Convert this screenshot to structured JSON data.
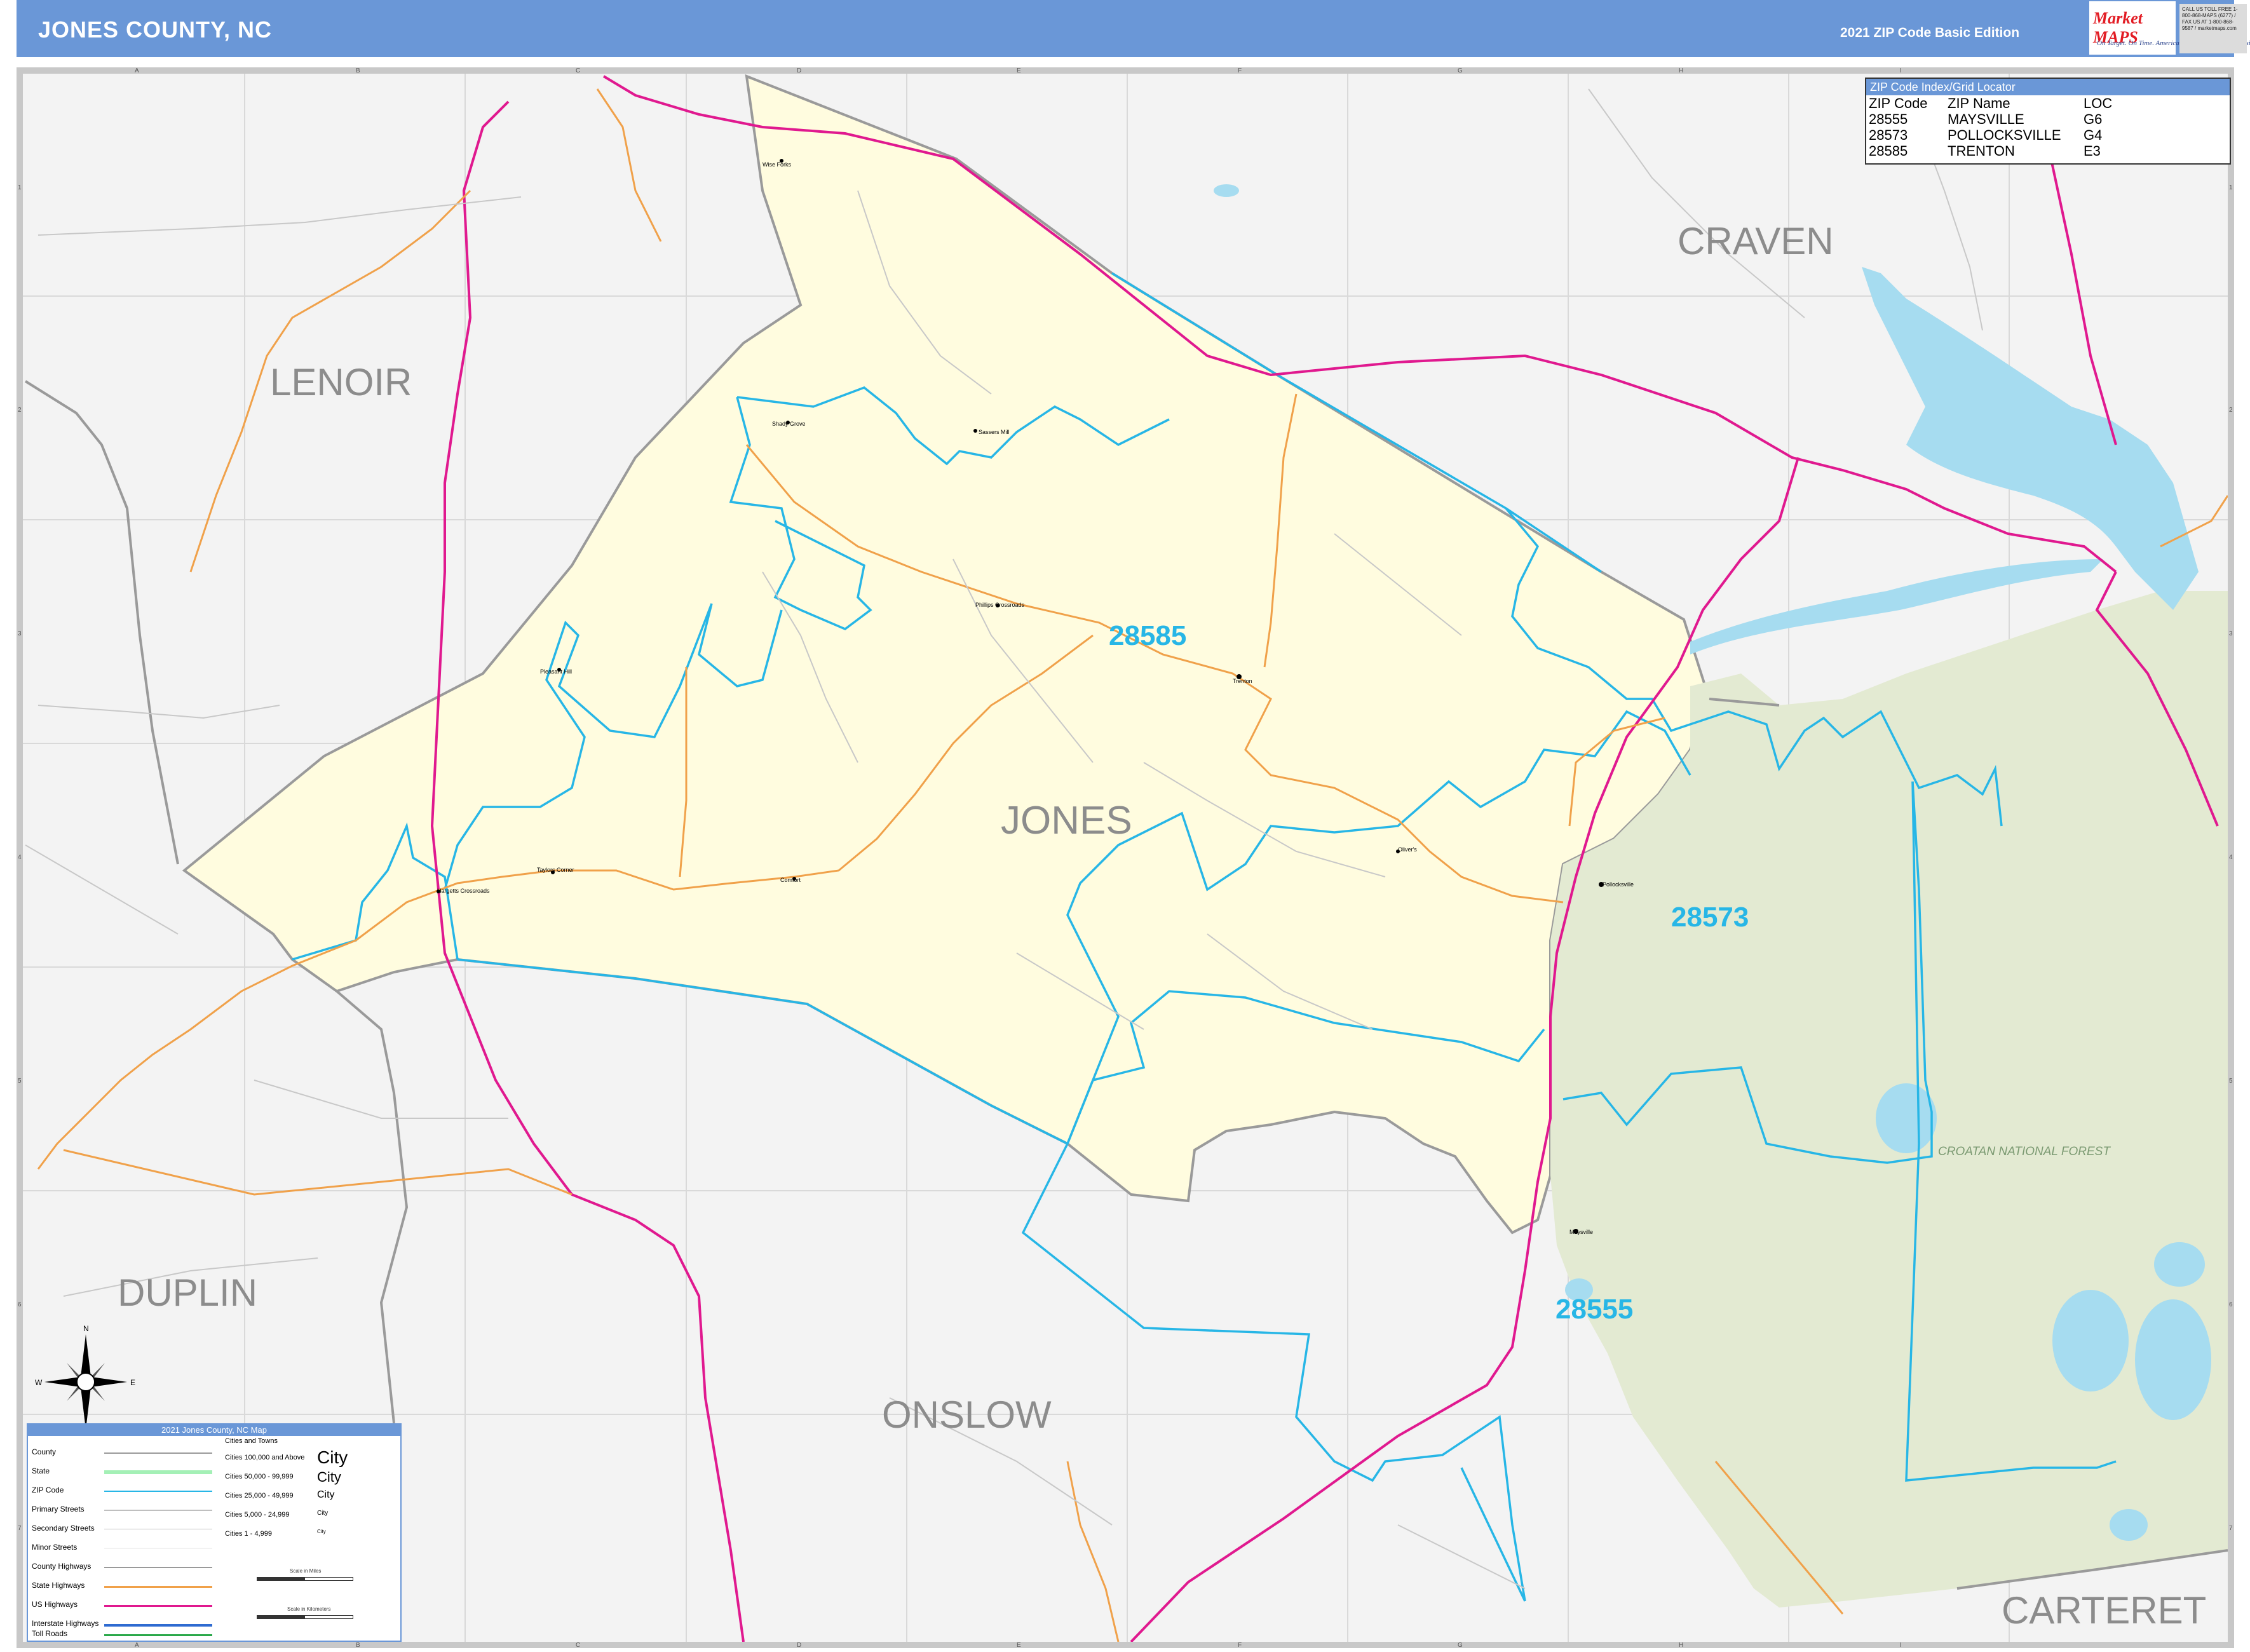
{
  "header": {
    "title": "JONES COUNTY, NC",
    "edition": "2021 ZIP Code Basic Edition",
    "logo_brand": "Market MAPS",
    "logo_tagline": "On Target. On Time. America's Leading Source of Business Maps",
    "contact_text": "CALL US TOLL FREE 1-800-868-MAPS (6277) / FAX US AT 1-800-868-9587 / marketmaps.com"
  },
  "grid": {
    "columns": [
      "A",
      "B",
      "C",
      "D",
      "E",
      "F",
      "G",
      "H",
      "I"
    ],
    "rows": [
      "1",
      "2",
      "3",
      "4",
      "5",
      "6",
      "7"
    ]
  },
  "map": {
    "county_labels": [
      "LENOIR",
      "CRAVEN",
      "JONES",
      "DUPLIN",
      "ONSLOW",
      "CARTERET"
    ],
    "zip_labels": [
      "28585",
      "28573",
      "28555"
    ],
    "forest_label": "CROATAN NATIONAL FOREST",
    "place_names": [
      "Wise Forks",
      "Shady Grove",
      "Sassers Mill",
      "Phillips Crossroads",
      "Trenton",
      "Pleasant Hill",
      "Taylors Corner",
      "Comfort",
      "Hargetts Crossroads",
      "Oliver's",
      "Pollocksville",
      "Maysville"
    ],
    "colors": {
      "county_fill": "#fffcdf",
      "forest_fill": "#e3ead2",
      "background_fill": "#f3f3f3",
      "zip_boundary": "#27b6e6",
      "us_highway": "#e0198f",
      "state_highway": "#f0a14a",
      "county_boundary": "#9a9a9a",
      "water": "#a6dcf0",
      "zip_label": "#27b6e6",
      "county_label": "#8c8c8c"
    }
  },
  "zip_index": {
    "title": "ZIP Code Index/Grid Locator",
    "headers": [
      "ZIP Code",
      "ZIP Name",
      "LOC"
    ],
    "rows": [
      [
        "28555",
        "MAYSVILLE",
        "G6"
      ],
      [
        "28573",
        "POLLOCKSVILLE",
        "G4"
      ],
      [
        "28585",
        "TRENTON",
        "E3"
      ]
    ]
  },
  "legend": {
    "title": "2021 Jones County, NC Map",
    "items": [
      "County",
      "State",
      "ZIP Code",
      "Primary Streets",
      "Secondary Streets",
      "Minor Streets",
      "County Highways",
      "State Highways",
      "US Highways",
      "Interstate Highways",
      "Toll Roads"
    ],
    "cities_header": "Cities and Towns",
    "city_classes": [
      "Cities 100,000 and Above",
      "Cities 50,000 - 99,999",
      "Cities 25,000 - 49,999",
      "Cities 5,000 - 24,999",
      "Cities 1 - 4,999"
    ],
    "city_samples": [
      "City",
      "City",
      "City",
      "City",
      "City"
    ],
    "scale_miles": "Scale in Miles",
    "scale_km": "Scale in Kilometers"
  },
  "compass": {
    "n": "N",
    "e": "E",
    "s": "S",
    "w": "W"
  }
}
